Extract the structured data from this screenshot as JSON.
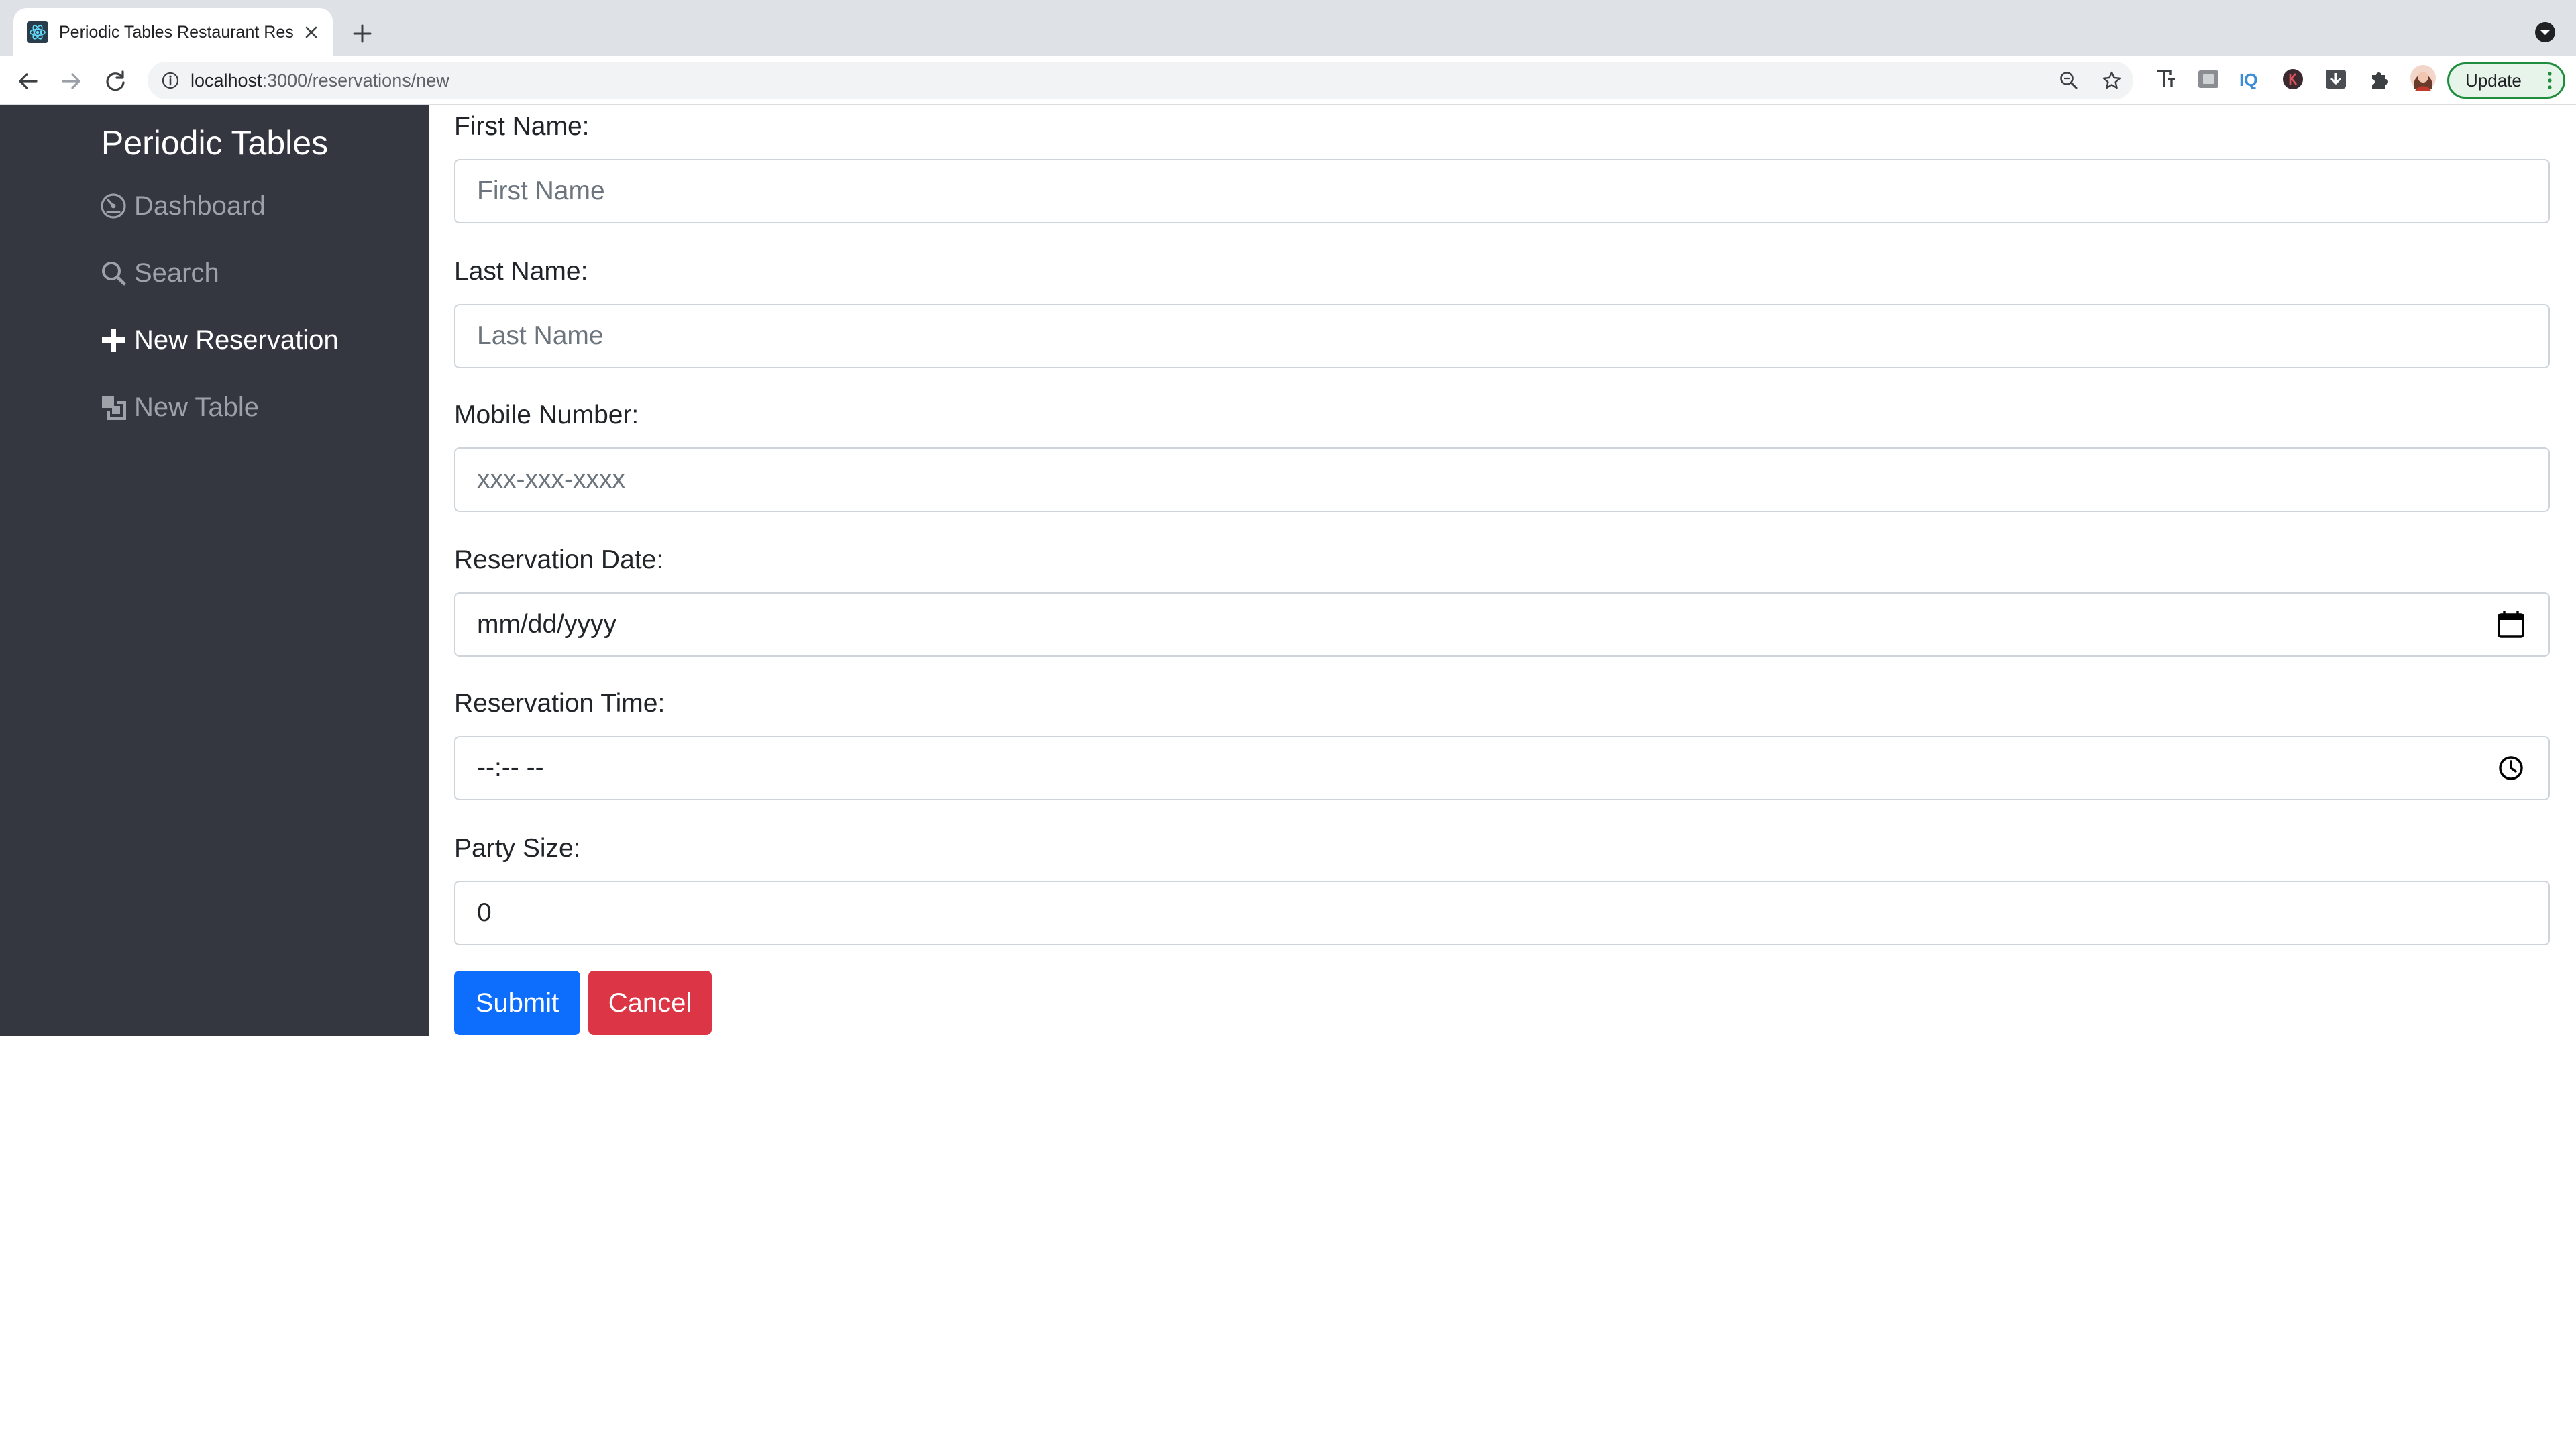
{
  "browser": {
    "tab_title": "Periodic Tables Restaurant Res",
    "url_host": "localhost",
    "url_rest": ":3000/reservations/new",
    "update_label": "Update"
  },
  "sidebar": {
    "brand": "Periodic Tables",
    "items": [
      {
        "label": "Dashboard",
        "icon": "dashboard-icon",
        "active": false
      },
      {
        "label": "Search",
        "icon": "search-icon",
        "active": false
      },
      {
        "label": "New Reservation",
        "icon": "plus-icon",
        "active": true
      },
      {
        "label": "New Table",
        "icon": "layers-icon",
        "active": false
      }
    ],
    "colors": {
      "background": "#343640",
      "active": "#ffffff",
      "inactive": "#9ea1a8"
    }
  },
  "form": {
    "first_name": {
      "label": "First Name:",
      "placeholder": "First Name"
    },
    "last_name": {
      "label": "Last Name:",
      "placeholder": "Last Name"
    },
    "mobile_number": {
      "label": "Mobile Number:",
      "placeholder": "xxx-xxx-xxxx"
    },
    "reservation_date": {
      "label": "Reservation Date:",
      "value": "mm/dd/yyyy"
    },
    "reservation_time": {
      "label": "Reservation Time:",
      "value": "--:-- --"
    },
    "party_size": {
      "label": "Party Size:",
      "value": "0"
    },
    "submit_label": "Submit",
    "cancel_label": "Cancel",
    "colors": {
      "submit": "#0d6efd",
      "cancel": "#dc3545"
    }
  }
}
